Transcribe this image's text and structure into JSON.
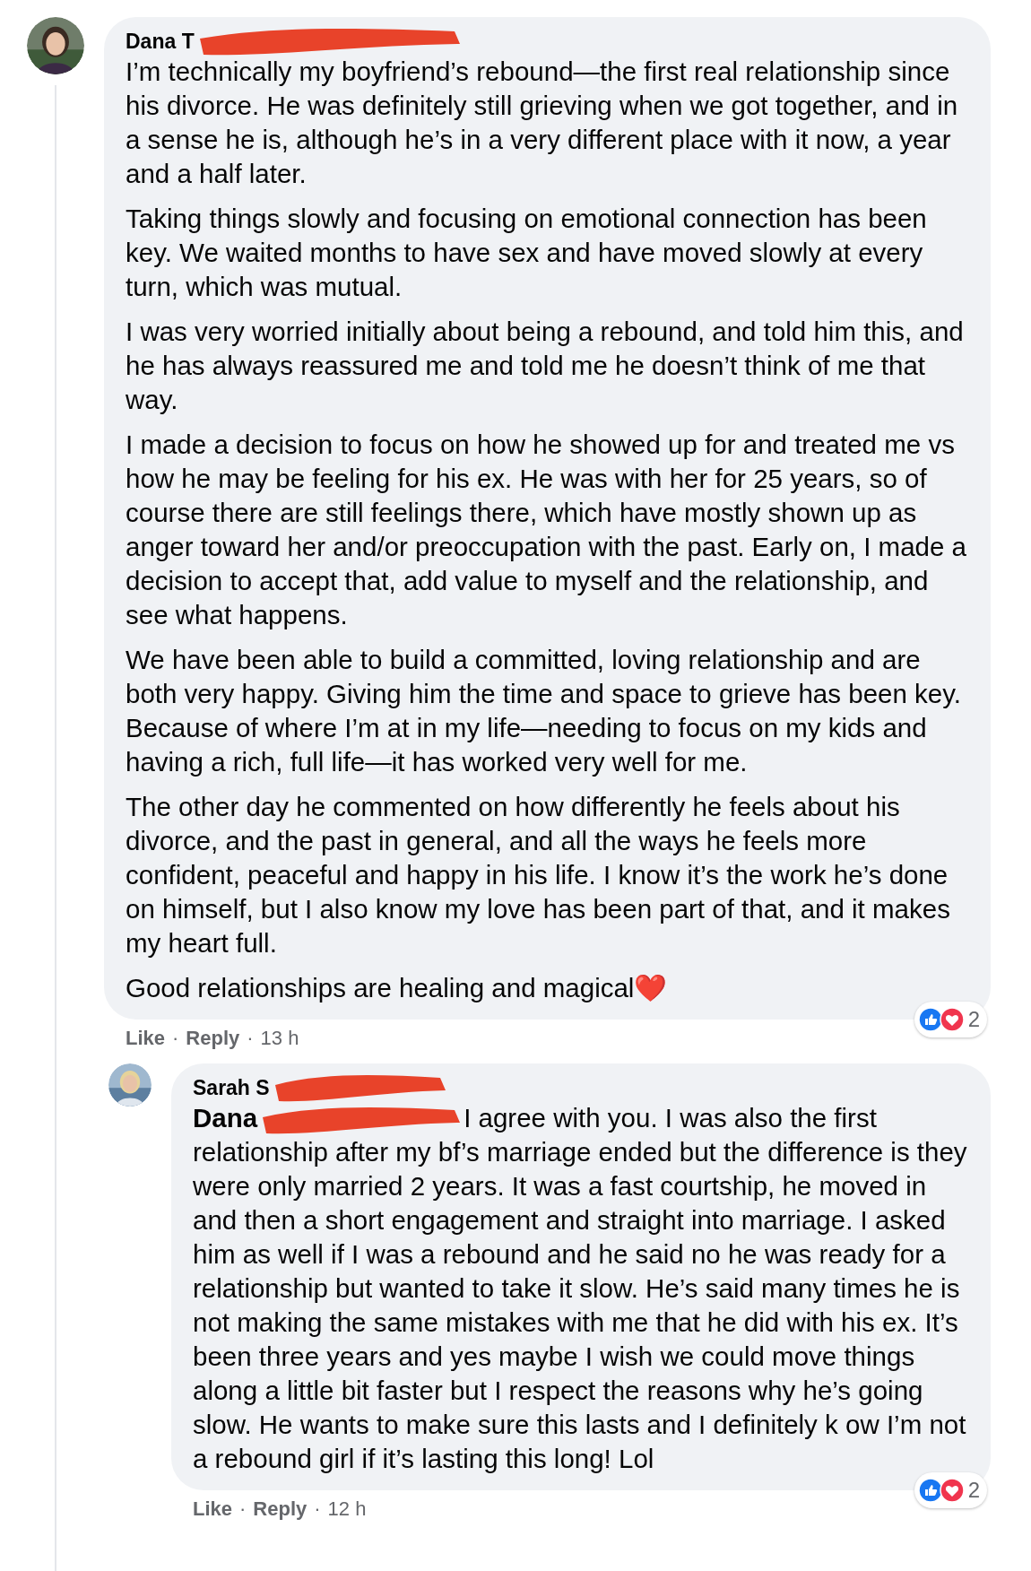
{
  "comments": [
    {
      "author": "Dana T",
      "paragraphs": [
        "I’m technically my boyfriend’s rebound—the first real relationship since his divorce. He was definitely still grieving when we got together, and in a sense he is, although he’s in a very different place with it now, a year and a half later.",
        "Taking things slowly and focusing on emotional connection has been key. We waited months to have sex and have moved slowly at every turn, which was mutual.",
        "I was very worried initially about being a rebound, and told him this, and he has always reassured me and told me he doesn’t think of me that way.",
        "I made a decision to focus on how he showed up for and treated me vs how he may be feeling for his ex. He was with her for 25 years, so of course there are still feelings there, which have mostly shown up as anger toward her and/or preoccupation with the past. Early on, I made a decision to accept that, add value to myself and the relationship, and see what happens.",
        "We have been able to build a committed, loving relationship and are both very happy. Giving him the time and space to grieve has been key. Because of where I’m at in my life—needing to focus on my kids and having a rich, full life—it has worked very well for me.",
        "The other day he commented on how differently he feels about his divorce, and the past in general, and all the ways he feels more confident, peaceful and happy in his life. I know it’s the work he’s done on himself, but I also know my love has been part of that, and it makes my heart full.",
        "Good relationships are healing and magical❤️"
      ],
      "actions": [
        "Like",
        "Reply"
      ],
      "separator": "·",
      "time": "13 h",
      "reaction_count": "2"
    },
    {
      "author": "Sarah S",
      "mention": "Dana",
      "paragraphs": [
        "I agree with you. I was also the first relationship after my bf’s marriage ended but the difference is they were only married 2 years. It was a fast courtship, he moved in and then a short engagement and straight into marriage. I asked him as well if I was a rebound and he said no he was ready for a relationship but wanted to take it slow. He’s said many times he is not making the same mistakes with me that he did with his ex. It’s been three years and yes maybe I wish we could move things along a little bit faster but I respect the reasons why he’s going slow. He wants to make sure this lasts and I definitely k ow I’m not a rebound girl if it’s lasting this long! Lol"
      ],
      "actions": [
        "Like",
        "Reply"
      ],
      "separator": "·",
      "time": "12 h",
      "reaction_count": "2"
    }
  ]
}
